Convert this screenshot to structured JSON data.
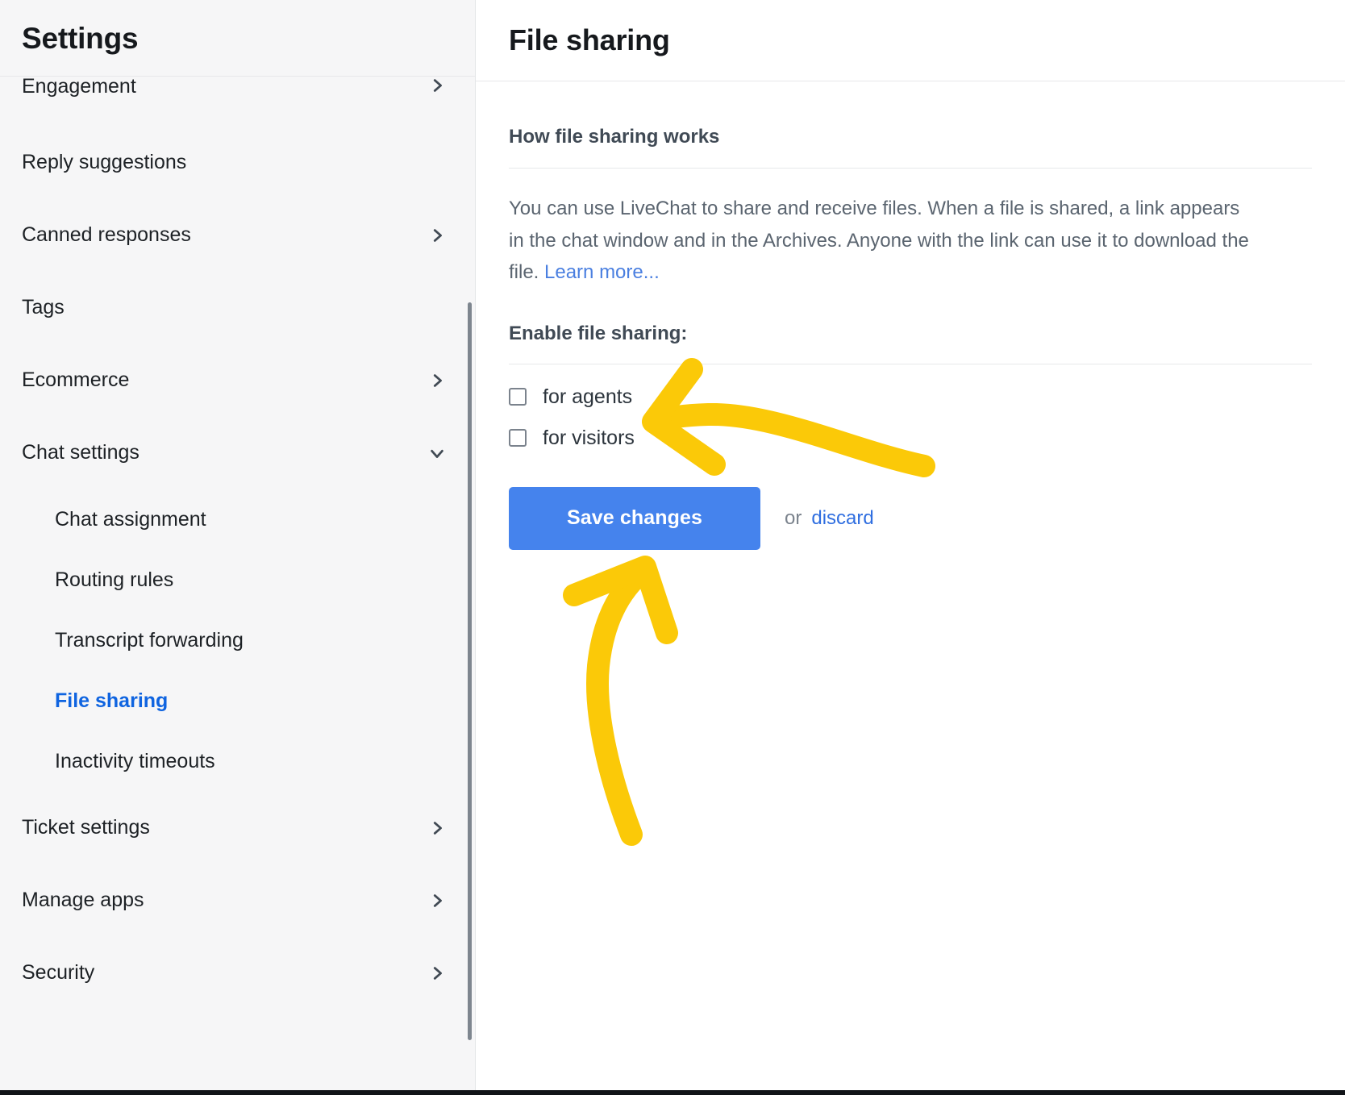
{
  "sidebar": {
    "title": "Settings",
    "items": [
      {
        "label": "Engagement",
        "chevron": "chevron-right-icon",
        "level": 0,
        "active": false
      },
      {
        "label": "Reply suggestions",
        "chevron": "none",
        "level": 0,
        "active": false
      },
      {
        "label": "Canned responses",
        "chevron": "chevron-right-icon",
        "level": 0,
        "active": false
      },
      {
        "label": "Tags",
        "chevron": "none",
        "level": 0,
        "active": false
      },
      {
        "label": "Ecommerce",
        "chevron": "chevron-right-icon",
        "level": 0,
        "active": false
      },
      {
        "label": "Chat settings",
        "chevron": "chevron-down-icon",
        "level": 0,
        "active": false
      },
      {
        "label": "Chat assignment",
        "chevron": "none",
        "level": 1,
        "active": false
      },
      {
        "label": "Routing rules",
        "chevron": "none",
        "level": 1,
        "active": false
      },
      {
        "label": "Transcript forwarding",
        "chevron": "none",
        "level": 1,
        "active": false
      },
      {
        "label": "File sharing",
        "chevron": "none",
        "level": 1,
        "active": true
      },
      {
        "label": "Inactivity timeouts",
        "chevron": "none",
        "level": 1,
        "active": false
      },
      {
        "label": "Ticket settings",
        "chevron": "chevron-right-icon",
        "level": 0,
        "active": false
      },
      {
        "label": "Manage apps",
        "chevron": "chevron-right-icon",
        "level": 0,
        "active": false
      },
      {
        "label": "Security",
        "chevron": "chevron-right-icon",
        "level": 0,
        "active": false
      }
    ]
  },
  "header": {
    "title": "File sharing"
  },
  "main": {
    "section_title": "How file sharing works",
    "description": "You can use LiveChat to share and receive files. When a file is shared, a link appears in the chat window and in the Archives. Anyone with the link can use it to download the file. ",
    "learn_more_label": "Learn more...",
    "enable_label": "Enable file sharing:",
    "checkboxes": [
      {
        "label": "for agents",
        "checked": false
      },
      {
        "label": "for visitors",
        "checked": false
      }
    ],
    "save_label": "Save changes",
    "or_label": "or",
    "discard_label": "discard"
  },
  "annotations": {
    "arrow_to_checkboxes": "yellow-curved-arrow-pointing-left-at-checkboxes",
    "arrow_to_save": "yellow-curved-arrow-pointing-up-at-save-button",
    "color": "#fbc908"
  },
  "colors": {
    "accent_blue": "#0f64e0",
    "button_blue": "#4583ed",
    "link_blue": "#2f6ee0",
    "sidebar_bg": "#f6f6f7",
    "annotation_yellow": "#fbc908"
  }
}
